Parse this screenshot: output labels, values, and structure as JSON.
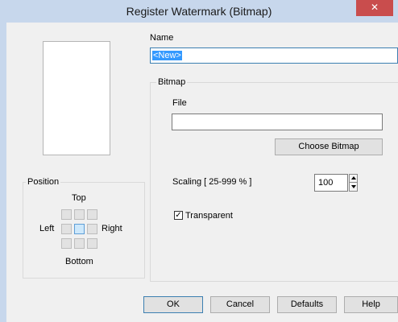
{
  "window": {
    "title": "Register Watermark (Bitmap)",
    "close_icon": "close-icon (×)"
  },
  "name": {
    "label": "Name",
    "value": "<New>"
  },
  "position": {
    "label": "Position",
    "top": "Top",
    "left": "Left",
    "right": "Right",
    "bottom": "Bottom",
    "selected": "center"
  },
  "bitmap": {
    "label": "Bitmap",
    "file_label": "File",
    "file_value": "",
    "choose_button": "Choose Bitmap",
    "scaling_label": "Scaling [ 25-999 % ]",
    "scaling_value": "100",
    "transparent_label": "Transparent",
    "transparent_checked": true
  },
  "buttons": {
    "ok": "OK",
    "cancel": "Cancel",
    "defaults": "Defaults",
    "help": "Help"
  }
}
